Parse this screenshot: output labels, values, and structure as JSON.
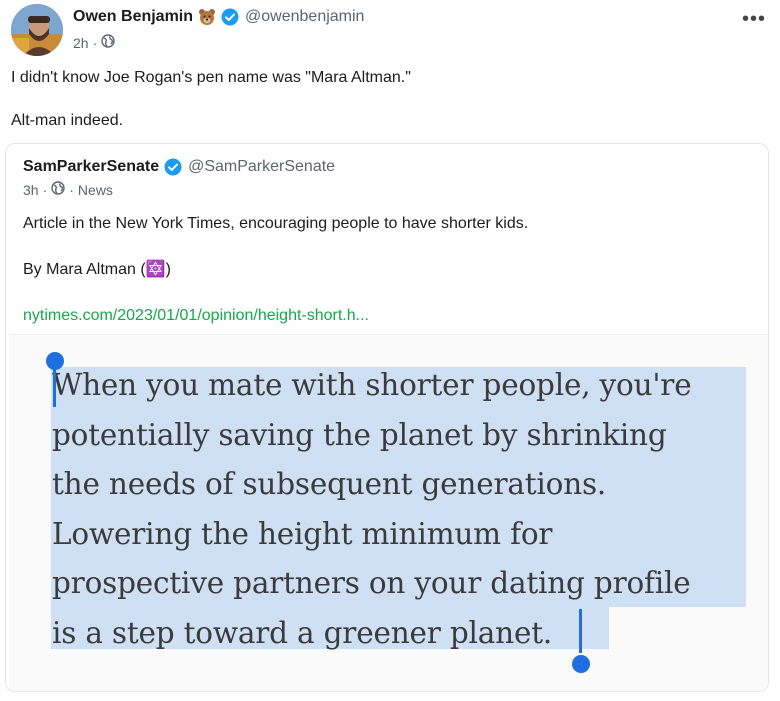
{
  "post": {
    "author_name": "Owen Benjamin",
    "author_handle": "@owenbenjamin",
    "time": "2h",
    "visibility_icon": "globe-icon",
    "text_lines": [
      "I didn't know Joe Rogan's pen name was \"Mara Altman.\"",
      "Alt-man indeed."
    ]
  },
  "quote": {
    "author_name": "SamParkerSenate",
    "author_handle": "@SamParkerSenate",
    "time": "3h",
    "category": "News",
    "text": "Article in the New York Times, encouraging people to have shorter kids.",
    "byline": "By Mara Altman (🔯)",
    "link": "nytimes.com/2023/01/01/opinion/height-short.h...",
    "image_text_lines": [
      "When you mate with shorter people, you're",
      "potentially saving the planet by shrinking",
      "the needs of subsequent generations.",
      "Lowering the height minimum for",
      "prospective partners on your dating profile",
      "is a step toward a greener planet."
    ]
  },
  "colors": {
    "verified": "#1d9bf0",
    "link": "#17a84a",
    "highlight": "#cfe0f5",
    "selection_handle": "#1f6fe0"
  },
  "icons": {
    "bear": "bear-emoji-icon",
    "verified": "verified-badge-icon",
    "more": "more-options-icon"
  }
}
